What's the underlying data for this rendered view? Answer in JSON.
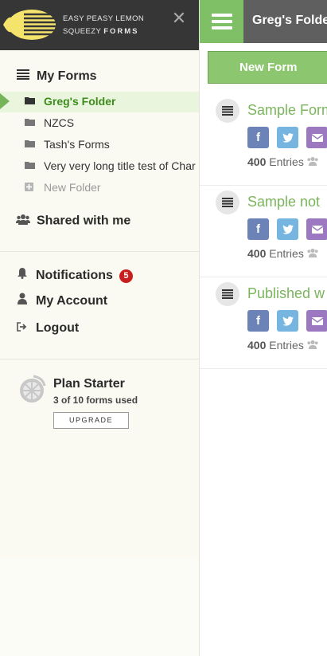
{
  "brand": {
    "line1": "EASY PEASY LEMON",
    "line2": "SQUEEZY",
    "line2_bold": "FORMS",
    "accent": "#7fbf66",
    "logo_yellow": "#f5e46b"
  },
  "sidebar": {
    "my_forms_label": "My Forms",
    "folders": [
      {
        "label": "Greg's Folder",
        "active": true
      },
      {
        "label": "NZCS"
      },
      {
        "label": "Tash's Forms"
      },
      {
        "label": "Very very long title test of Char"
      }
    ],
    "new_folder_label": "New Folder",
    "shared_label": "Shared with me",
    "account": {
      "notifications_label": "Notifications",
      "notifications_count": "5",
      "my_account_label": "My Account",
      "logout_label": "Logout"
    },
    "plan": {
      "title": "Plan Starter",
      "usage": "3 of 10 forms used",
      "upgrade_label": "UPGRADE"
    }
  },
  "main": {
    "folder_title": "Greg's Folder",
    "new_form_label": "New Form",
    "forms": [
      {
        "title": "Sample Form",
        "entries": "400",
        "entries_label": "Entries"
      },
      {
        "title": "Sample not",
        "entries": "400",
        "entries_label": "Entries"
      },
      {
        "title": "Published w",
        "entries": "400",
        "entries_label": "Entries"
      }
    ]
  },
  "icons": [
    "menu-list-icon",
    "folder-icon",
    "plus-icon",
    "users-icon",
    "bell-icon",
    "user-icon",
    "logout-icon",
    "close-icon",
    "hamburger-icon",
    "facebook-icon",
    "twitter-icon",
    "email-icon",
    "lemon-icon"
  ]
}
